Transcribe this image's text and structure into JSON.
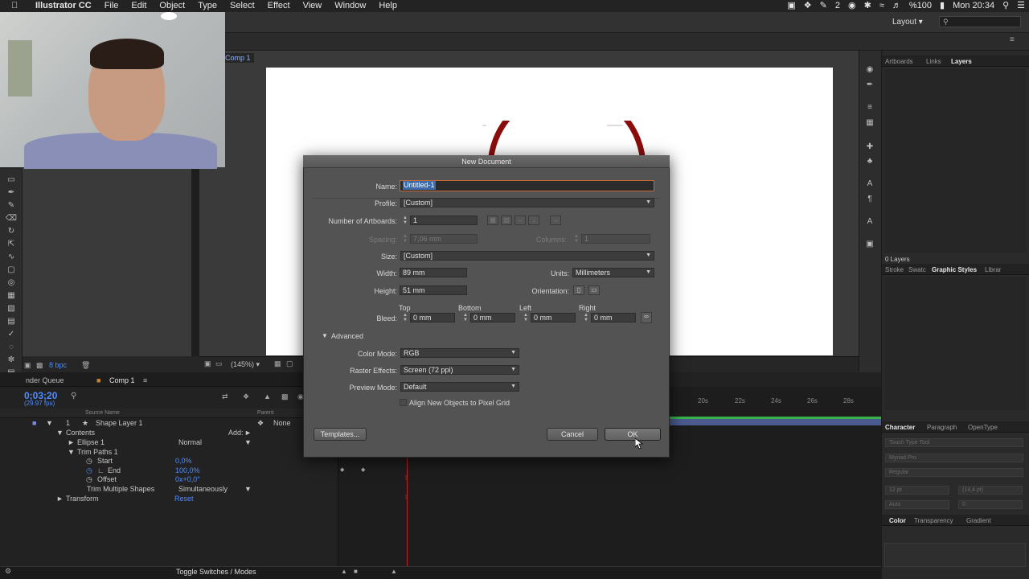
{
  "menubar": {
    "app": "Illustrator CC",
    "items": [
      "File",
      "Edit",
      "Object",
      "Type",
      "Select",
      "Effect",
      "View",
      "Window",
      "Help"
    ],
    "status": {
      "spaces": "2",
      "battery": "%100",
      "clock": "Mon 20:34"
    }
  },
  "control": {
    "layout_label": "Layout"
  },
  "canvas": {
    "comp_tab": "Comp 1",
    "bpc": "8 bpc",
    "zoom": "(145%)"
  },
  "timeline": {
    "tab_render": "nder Queue",
    "tab_comp": "Comp 1",
    "timecode": "0;03;20",
    "fps": "(29.97 fps)",
    "headers": {
      "source": "Source Name",
      "parent": "Parent"
    },
    "layer": {
      "index": "1",
      "name": "Shape Layer 1",
      "parent": "None"
    },
    "rows": [
      {
        "label": "Contents",
        "value": "Add:"
      },
      {
        "label": "Ellipse 1",
        "value": "Normal"
      },
      {
        "label": "Trim Paths 1",
        "value": ""
      },
      {
        "label": "Start",
        "value": "0,0%"
      },
      {
        "label": "End",
        "value": "100,0%"
      },
      {
        "label": "Offset",
        "value": "0x+0,0°"
      },
      {
        "label": "Trim Multiple Shapes",
        "value": "Simultaneously"
      },
      {
        "label": "Transform",
        "value": "Reset"
      }
    ],
    "ruler": [
      "20s",
      "22s",
      "24s",
      "26s",
      "28s"
    ],
    "toggle": "Toggle Switches / Modes"
  },
  "right_panel": {
    "tabs1": [
      "Artboards",
      "Links",
      "Layers"
    ],
    "layers_count": "0 Layers",
    "tabs2": [
      "Stroke",
      "Swatc",
      "Graphic Styles",
      "Librar"
    ],
    "tabs3": [
      "Character",
      "Paragraph",
      "OpenType"
    ],
    "touch_type": "Touch Type Tool",
    "font_family": "Myriad Pro",
    "font_style": "Regular",
    "size": "12 pt",
    "leading": "(14,4 pt)",
    "tracking": "Auto",
    "kerning": "0",
    "tabs4": [
      "Color",
      "Transparency",
      "Gradient"
    ]
  },
  "dialog": {
    "title": "New Document",
    "name_label": "Name:",
    "name_value": "Untitled-1",
    "profile_label": "Profile:",
    "profile_value": "[Custom]",
    "artboards_label": "Number of Artboards:",
    "artboards_value": "1",
    "spacing_label": "Spacing:",
    "spacing_value": "7,06 mm",
    "columns_label": "Columns:",
    "columns_value": "1",
    "size_label": "Size:",
    "size_value": "[Custom]",
    "width_label": "Width:",
    "width_value": "89 mm",
    "units_label": "Units:",
    "units_value": "Millimeters",
    "height_label": "Height:",
    "height_value": "51 mm",
    "orientation_label": "Orientation:",
    "bleed_label": "Bleed:",
    "bleed_top_label": "Top",
    "bleed_bottom_label": "Bottom",
    "bleed_left_label": "Left",
    "bleed_right_label": "Right",
    "bleed_top": "0 mm",
    "bleed_bottom": "0 mm",
    "bleed_left": "0 mm",
    "bleed_right": "0 mm",
    "advanced_label": "Advanced",
    "color_mode_label": "Color Mode:",
    "color_mode_value": "RGB",
    "raster_label": "Raster Effects:",
    "raster_value": "Screen (72 ppi)",
    "preview_label": "Preview Mode:",
    "preview_value": "Default",
    "align_label": "Align New Objects to Pixel Grid",
    "templates_button": "Templates...",
    "cancel_button": "Cancel",
    "ok_button": "OK"
  },
  "colors": {
    "accent": "#4f8cff",
    "arc": "#8a0d0d",
    "playhead": "#c02020",
    "workarea_green": "#37b34a"
  }
}
